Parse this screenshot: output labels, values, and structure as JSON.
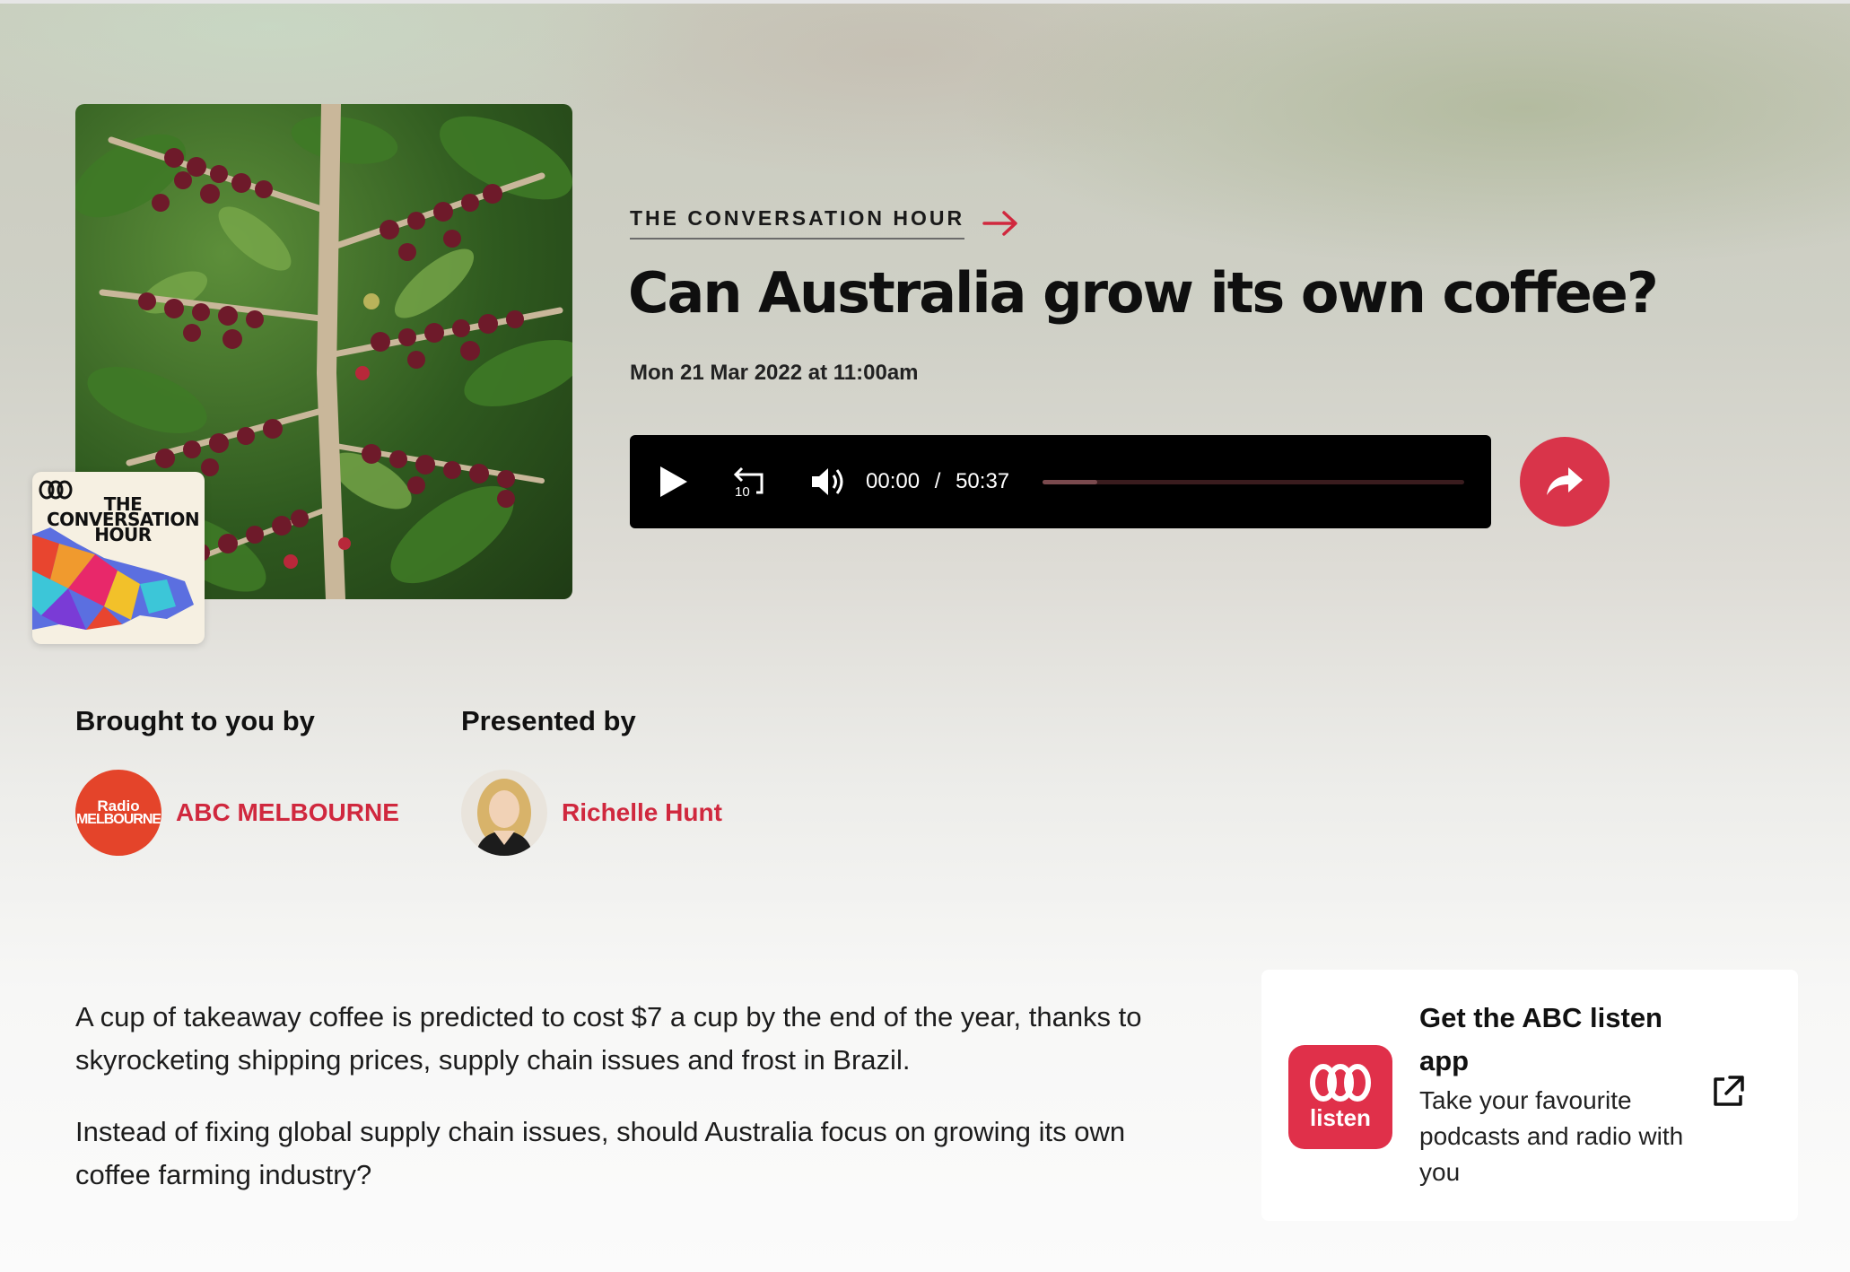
{
  "program": {
    "name": "THE CONVERSATION HOUR",
    "badge_text": "THE CONVERSATION HOUR",
    "arrow_icon": "arrow-right-icon"
  },
  "episode": {
    "title": "Can Australia grow its own coffee?",
    "date": "Mon 21 Mar 2022 at 11:00am"
  },
  "player": {
    "current_time": "00:00",
    "separator": "/",
    "duration": "50:37",
    "progress_fraction": 0.13,
    "icons": [
      "play-icon",
      "rewind-10-icon",
      "volume-icon"
    ],
    "rewind_label": "10"
  },
  "share": {
    "icon": "share-icon",
    "color": "#d9344a"
  },
  "credits": {
    "brought_label": "Brought to you by",
    "brought_name": "ABC MELBOURNE",
    "abc_logo_line1": "Radio",
    "abc_logo_line2": "MELBOURNE",
    "presented_label": "Presented by",
    "presenter_name": "Richelle Hunt"
  },
  "description": {
    "paragraphs": [
      "A cup of takeaway coffee is predicted to cost $7 a cup by the end of the year, thanks to skyrocketing shipping prices, supply chain issues and frost in Brazil.",
      "Instead of fixing global supply chain issues, should Australia focus on growing its own coffee farming industry?"
    ]
  },
  "app_promo": {
    "title": "Get the ABC listen app",
    "subtitle": "Take your favourite podcasts and radio with you",
    "icon_word": "listen",
    "link_icon": "external-link-icon"
  },
  "colors": {
    "accent": "#d0283e",
    "player_bg": "#000000",
    "abc_orange": "#e4442a"
  }
}
